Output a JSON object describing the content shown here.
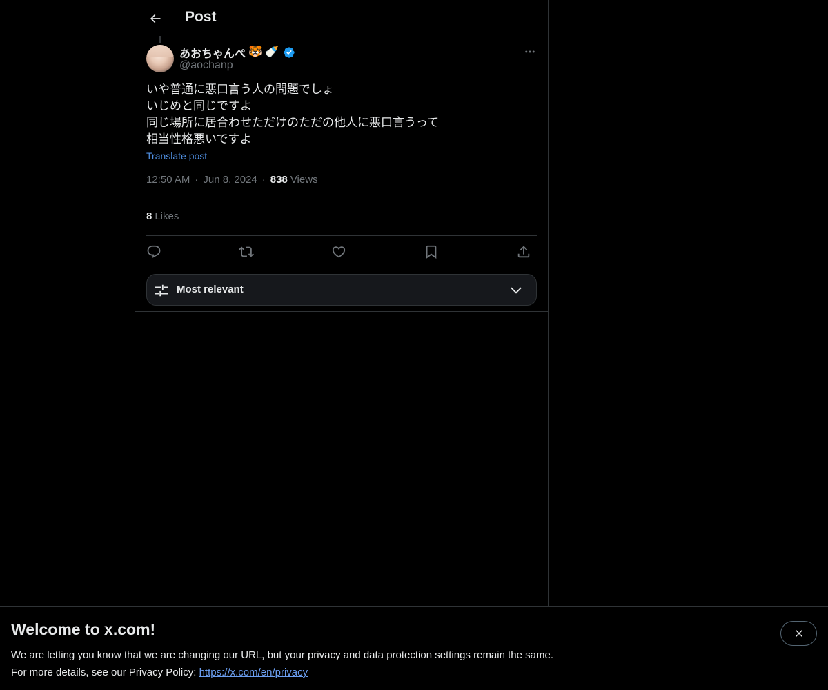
{
  "header": {
    "title": "Post",
    "back_icon": "arrow-left-icon"
  },
  "post": {
    "author": {
      "display_name": "あおちゃんぺ",
      "emojis": [
        "🐯",
        "🍼"
      ],
      "verified": true,
      "handle": "@aochanp"
    },
    "text_lines": [
      "いや普通に悪口言う人の問題でしょ",
      "いじめと同じですよ",
      "同じ場所に居合わせただけのただの他人に悪口言うって",
      "相当性格悪いですよ"
    ],
    "translate_label": "Translate post",
    "time": "12:50 AM",
    "date": "Jun 8, 2024",
    "views_count": "838",
    "views_label": "Views",
    "likes_count": "8",
    "likes_label": "Likes"
  },
  "actions": [
    "reply-icon",
    "repost-icon",
    "like-icon",
    "bookmark-icon",
    "share-icon"
  ],
  "sort": {
    "label": "Most relevant"
  },
  "banner": {
    "title": "Welcome to x.com!",
    "line1": "We are letting you know that we are changing our URL, but your privacy and data protection settings remain the same.",
    "line2_prefix": "For more details, see our Privacy Policy: ",
    "link_text": "https://x.com/en/privacy"
  },
  "colors": {
    "background": "#000000",
    "text": "#e7e9ea",
    "muted": "#71767b",
    "accent": "#1d9bf0",
    "border": "#2f3336"
  }
}
